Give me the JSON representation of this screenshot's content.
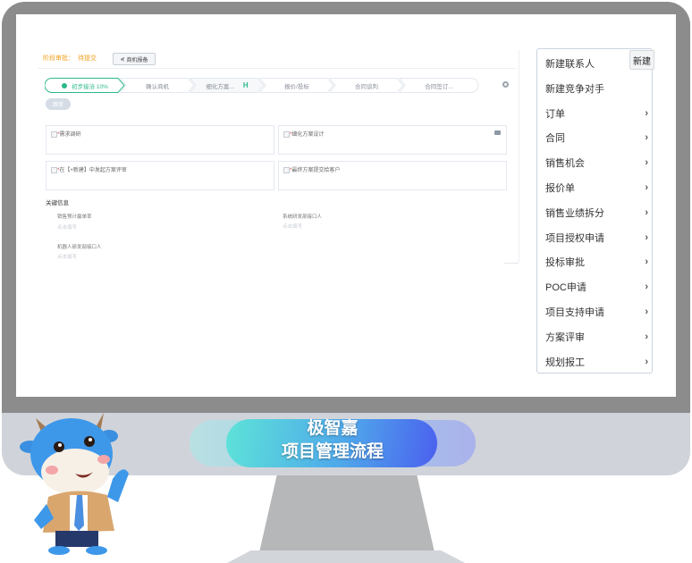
{
  "crm": {
    "stage_approval_label": "阶段审批：",
    "stage_approval_value": "待提交",
    "report_button": "商机报备",
    "pipeline_steps": [
      {
        "label": "初步接洽 10%",
        "active": true
      },
      {
        "label": "确认商机",
        "active": false
      },
      {
        "label": "细化方案...",
        "active": false
      },
      {
        "label": "报价/投标",
        "active": false
      },
      {
        "label": "合同谈判",
        "active": false
      },
      {
        "label": "合同签订...",
        "active": false
      }
    ],
    "follow_button": "跟单",
    "tasks": [
      {
        "label": "需求调研",
        "required": "*"
      },
      {
        "label": "细化方案设计",
        "required": "*"
      },
      {
        "label": "在【+新建】中发起方案评审",
        "required": "*"
      },
      {
        "label": "最终方案提交给客户",
        "required": "*"
      }
    ],
    "key_info_title": "关键信息",
    "fields": [
      {
        "label": "销售预计赢单率",
        "value": "点击填写"
      },
      {
        "label": "系统研发部接口人",
        "value": "点击填写"
      },
      {
        "label": "机器人研发部接口人",
        "value": "点击填写"
      }
    ]
  },
  "menu": {
    "tooltip": "新建",
    "items": [
      {
        "label": "新建联系人",
        "has_submenu": false
      },
      {
        "label": "新建竞争对手",
        "has_submenu": false
      },
      {
        "label": "订单",
        "has_submenu": true
      },
      {
        "label": "合同",
        "has_submenu": true
      },
      {
        "label": "销售机会",
        "has_submenu": true
      },
      {
        "label": "报价单",
        "has_submenu": true
      },
      {
        "label": "销售业绩拆分",
        "has_submenu": true
      },
      {
        "label": "项目授权申请",
        "has_submenu": true
      },
      {
        "label": "投标审批",
        "has_submenu": true
      },
      {
        "label": "POC申请",
        "has_submenu": true
      },
      {
        "label": "项目支持申请",
        "has_submenu": true
      },
      {
        "label": "方案评审",
        "has_submenu": true
      },
      {
        "label": "规划报工",
        "has_submenu": true
      }
    ],
    "chevron": "›"
  },
  "banner": {
    "line1": "极智嘉",
    "line2": "项目管理流程"
  },
  "colors": {
    "accent_green": "#2cb989",
    "warning_orange": "#f0a020",
    "required_red": "#e03a3a"
  }
}
